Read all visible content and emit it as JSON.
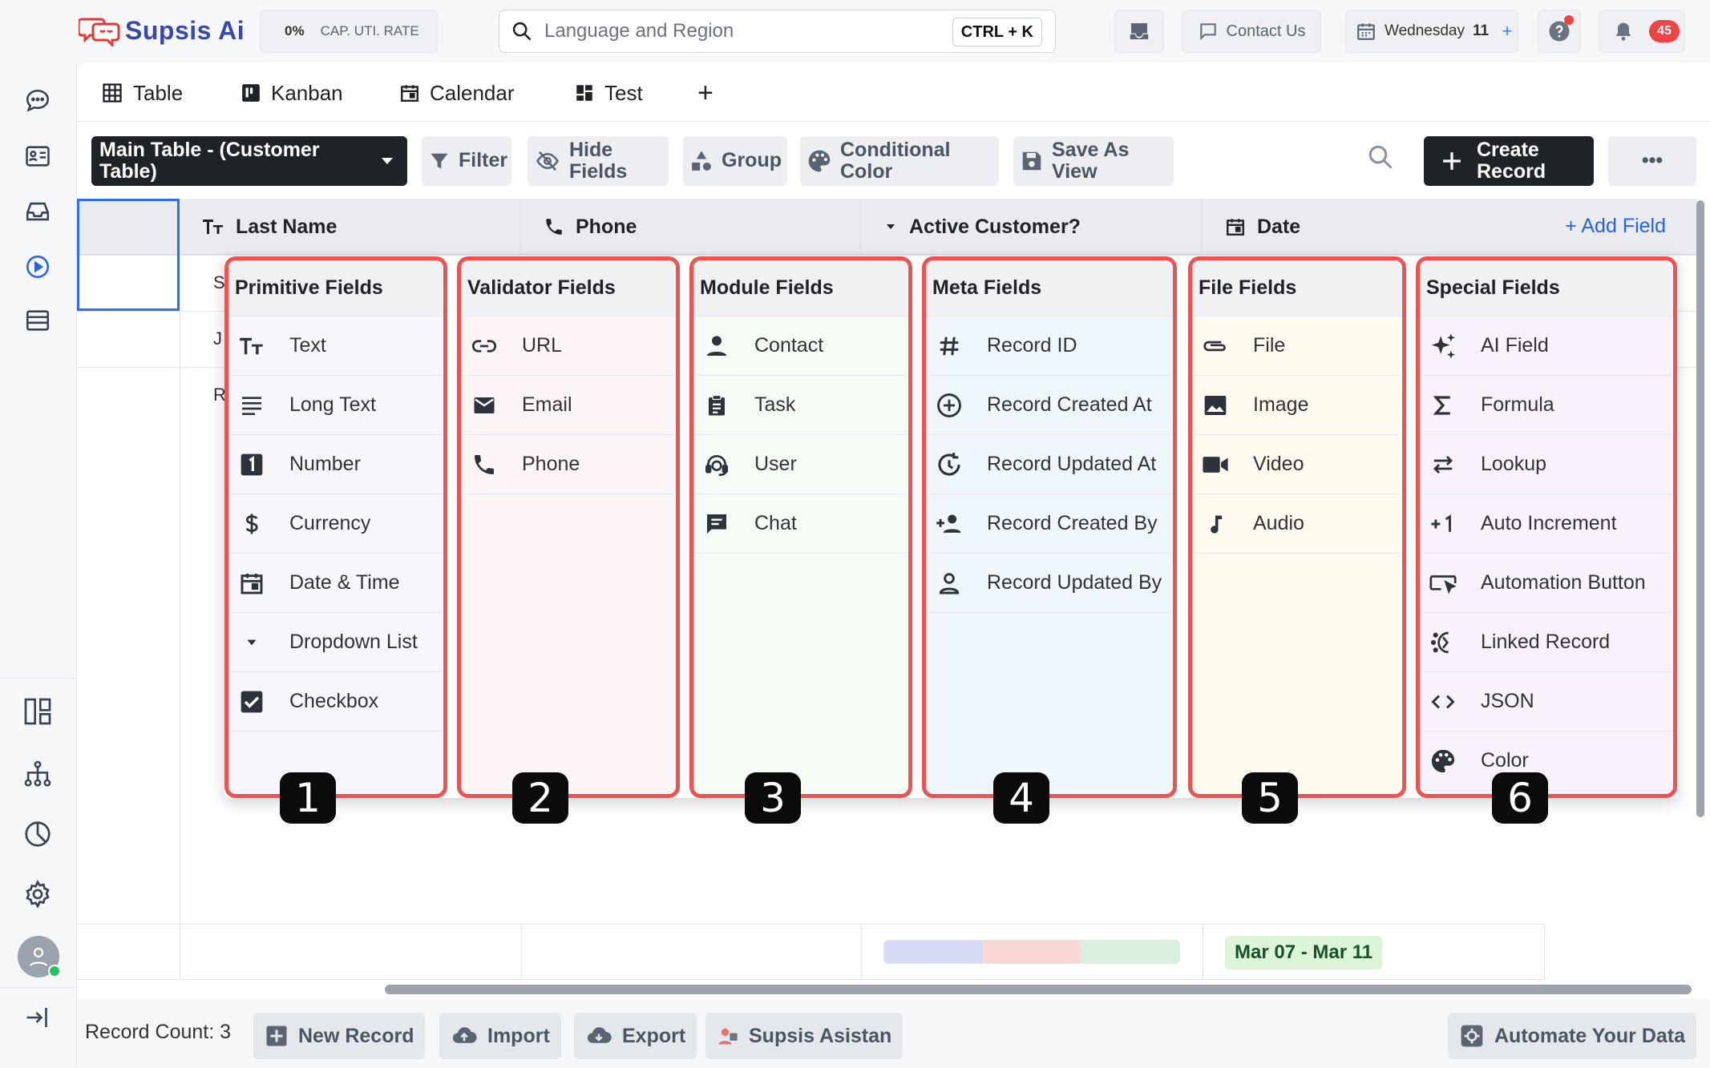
{
  "app": {
    "name": "Supsis Ai",
    "cap_rate_value": "0%",
    "cap_rate_label": "CAP. UTI. RATE",
    "search_placeholder": "Language and Region",
    "search_shortcut": "CTRL + K",
    "contact_label": "Contact Us",
    "date_label": "Wednesday",
    "date_day": "11",
    "date_add": "+",
    "notif_count": "45"
  },
  "tabs": [
    {
      "label": "Table"
    },
    {
      "label": "Kanban"
    },
    {
      "label": "Calendar"
    },
    {
      "label": "Test"
    }
  ],
  "tab_add": "+",
  "toolbar": {
    "table_select": "Main Table - (Customer Table)",
    "filter": "Filter",
    "hide_fields": "Hide Fields",
    "group": "Group",
    "conditional_color": "Conditional Color",
    "save_as_view": "Save As View",
    "create_record": "Create Record",
    "more": "•••"
  },
  "columns": [
    {
      "label": "Last Name",
      "icon": "text-type-icon"
    },
    {
      "label": "Phone",
      "icon": "phone-icon"
    },
    {
      "label": "Active Customer?",
      "icon": "dropdown-icon"
    },
    {
      "label": "Date",
      "icon": "calendar-icon"
    }
  ],
  "add_field": "+ Add Field",
  "rows": [
    {
      "initial": "S"
    },
    {
      "initial": "J"
    },
    {
      "initial": "R"
    }
  ],
  "footer_row": {
    "date_range": "Mar 07 - Mar 11",
    "color_segments": [
      "#d6d9f5",
      "#f9d8d4",
      "#d9f0df"
    ]
  },
  "bottombar": {
    "record_count": "Record Count: 3",
    "new_record": "New Record",
    "import": "Import",
    "export": "Export",
    "assistant": "Supsis Asistan",
    "automate": "Automate Your Data"
  },
  "field_categories": [
    {
      "title": "Primitive Fields",
      "number": "1",
      "bg": "#f7f6fd",
      "items": [
        {
          "label": "Text",
          "icon": "text-type-icon"
        },
        {
          "label": "Long Text",
          "icon": "long-text-icon"
        },
        {
          "label": "Number",
          "icon": "number-icon"
        },
        {
          "label": "Currency",
          "icon": "dollar-icon"
        },
        {
          "label": "Date & Time",
          "icon": "calendar-icon"
        },
        {
          "label": "Dropdown List",
          "icon": "dropdown-icon"
        },
        {
          "label": "Checkbox",
          "icon": "checkbox-icon"
        }
      ]
    },
    {
      "title": "Validator Fields",
      "number": "2",
      "bg": "#fdf5f5",
      "items": [
        {
          "label": "URL",
          "icon": "link-icon"
        },
        {
          "label": "Email",
          "icon": "email-icon"
        },
        {
          "label": "Phone",
          "icon": "phone-icon"
        }
      ]
    },
    {
      "title": "Module Fields",
      "number": "3",
      "bg": "#f5fcf6",
      "items": [
        {
          "label": "Contact",
          "icon": "person-icon"
        },
        {
          "label": "Task",
          "icon": "clipboard-icon"
        },
        {
          "label": "User",
          "icon": "support-agent-icon"
        },
        {
          "label": "Chat",
          "icon": "chat-icon"
        }
      ]
    },
    {
      "title": "Meta Fields",
      "number": "4",
      "bg": "#eff7fd",
      "items": [
        {
          "label": "Record ID",
          "icon": "hash-icon"
        },
        {
          "label": "Record Created At",
          "icon": "add-circle-icon"
        },
        {
          "label": "Record Updated At",
          "icon": "refresh-clock-icon"
        },
        {
          "label": "Record Created By",
          "icon": "person-add-icon"
        },
        {
          "label": "Record Updated By",
          "icon": "person-outline-icon"
        }
      ]
    },
    {
      "title": "File Fields",
      "number": "5",
      "bg": "#fefaf0",
      "items": [
        {
          "label": "File",
          "icon": "attachment-icon"
        },
        {
          "label": "Image",
          "icon": "image-icon"
        },
        {
          "label": "Video",
          "icon": "video-icon"
        },
        {
          "label": "Audio",
          "icon": "music-note-icon"
        }
      ]
    },
    {
      "title": "Special Fields",
      "number": "6",
      "bg": "#f8f2fd",
      "items": [
        {
          "label": "AI Field",
          "icon": "sparkle-icon"
        },
        {
          "label": "Formula",
          "icon": "sigma-icon"
        },
        {
          "label": "Lookup",
          "icon": "swap-icon"
        },
        {
          "label": "Auto Increment",
          "icon": "plus-one-icon"
        },
        {
          "label": "Automation Button",
          "icon": "button-click-icon"
        },
        {
          "label": "Linked Record",
          "icon": "linked-icon"
        },
        {
          "label": "JSON",
          "icon": "code-icon"
        },
        {
          "label": "Color",
          "icon": "palette-icon"
        }
      ]
    }
  ]
}
